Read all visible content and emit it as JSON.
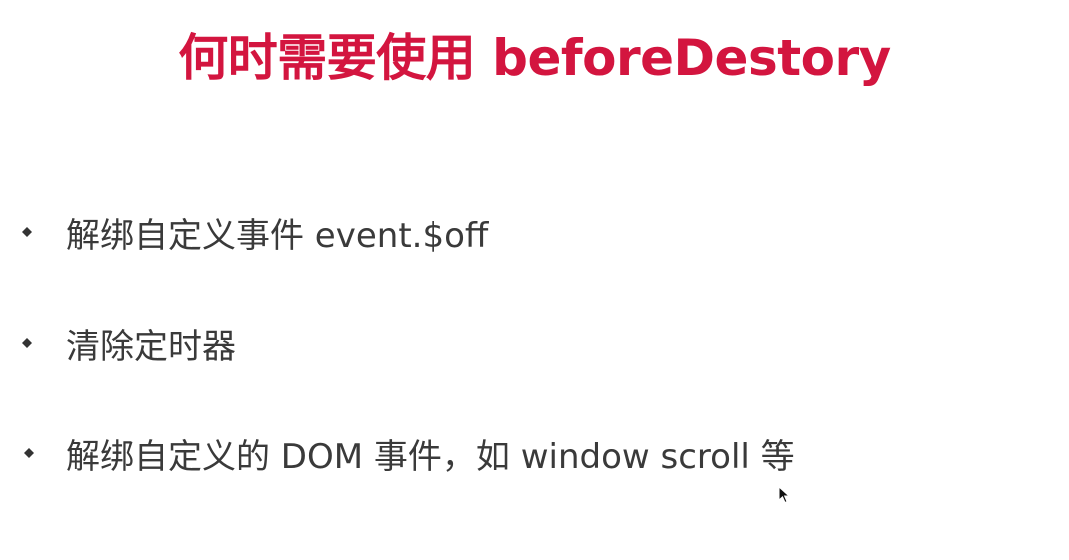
{
  "slide": {
    "title": "何时需要使用 beforeDestory",
    "title_color": "#d3153f",
    "bullet_color": "#3a3a3a",
    "bullets": [
      {
        "text": "解绑自定义事件 event.$off"
      },
      {
        "text": "清除定时器"
      },
      {
        "text": "解绑自定义的 DOM 事件，如 window scroll 等"
      }
    ],
    "bullet_icon": "diamond-bullet-icon",
    "cursor_icon": "mouse-pointer-icon"
  }
}
